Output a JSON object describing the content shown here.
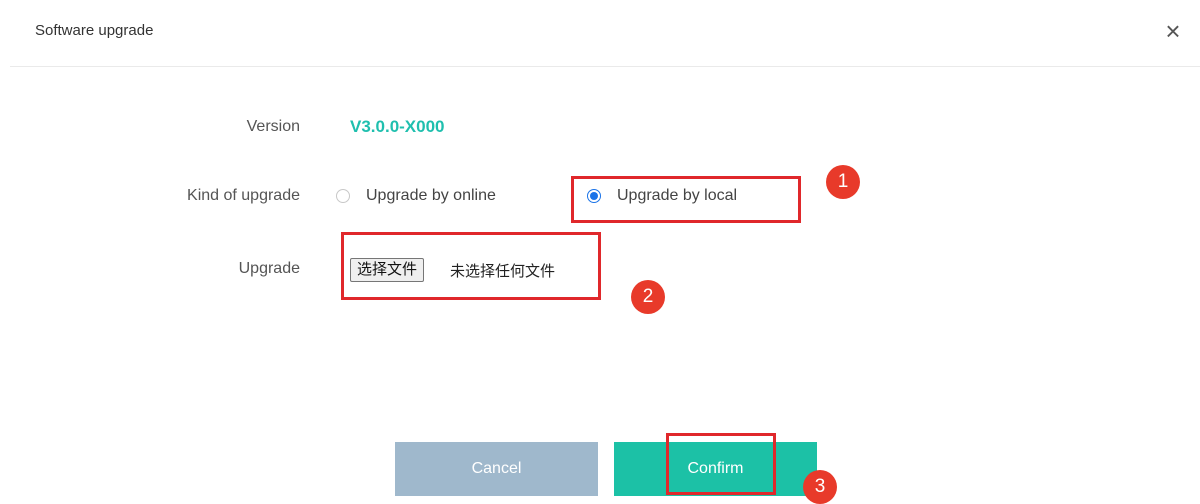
{
  "dialog": {
    "title": "Software upgrade",
    "close_icon": "close-icon",
    "close_glyph": "×"
  },
  "form": {
    "version_label": "Version",
    "version_value": "V3.0.0-X000",
    "kind_label": "Kind of upgrade",
    "options": [
      {
        "label": "Upgrade by online",
        "selected": false
      },
      {
        "label": "Upgrade by local",
        "selected": true
      }
    ],
    "upgrade_label": "Upgrade",
    "file_button": "选择文件",
    "file_status": "未选择任何文件"
  },
  "buttons": {
    "cancel": "Cancel",
    "confirm": "Confirm"
  },
  "annotations": [
    "1",
    "2",
    "3"
  ],
  "colors": {
    "accent": "#1cc1a6",
    "version": "#1fbfae",
    "cancel": "#9fb8cc",
    "annotation": "#e0282b"
  }
}
